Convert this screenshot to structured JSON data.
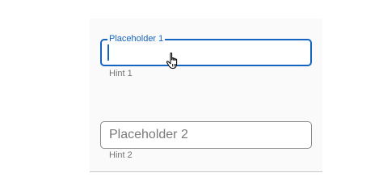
{
  "colors": {
    "accent": "#1565c0",
    "outline_idle": "#8a8a8a",
    "hint_text": "#757575",
    "panel_background": "#fafafa"
  },
  "fields": [
    {
      "label": "Placeholder 1",
      "hint": "Hint 1",
      "state": "focused",
      "value": ""
    },
    {
      "placeholder": "Placeholder 2",
      "hint": "Hint 2",
      "state": "idle",
      "value": ""
    }
  ],
  "cursor": {
    "icon": "hand-pointer-icon"
  }
}
